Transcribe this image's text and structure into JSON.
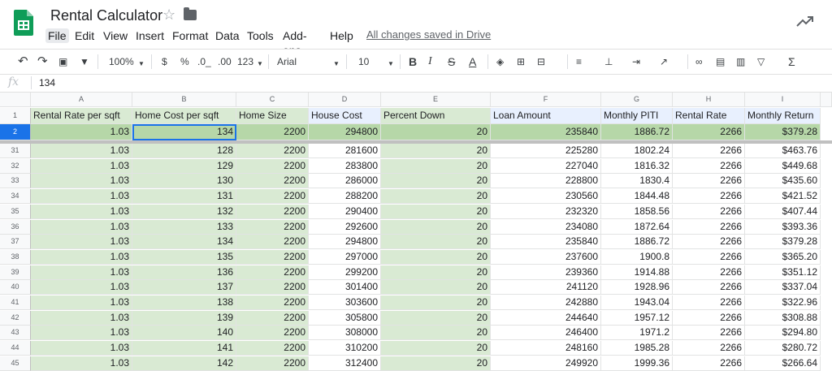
{
  "app": {
    "title": "Rental Calculator",
    "saved_status": "All changes saved in Drive",
    "menus": [
      "File",
      "Edit",
      "View",
      "Insert",
      "Format",
      "Data",
      "Tools",
      "Add-ons",
      "Help"
    ]
  },
  "toolbar": {
    "zoom": "100%",
    "currency": "$",
    "percent": "%",
    "dec_decrease": ".0_",
    "dec_increase": ".00",
    "more_formats": "123",
    "font": "Arial",
    "font_size": "10",
    "bold": "B",
    "italic": "I",
    "strike": "S",
    "text_color": "A",
    "sum": "Σ"
  },
  "formula_bar": {
    "fx": "fx",
    "value": "134"
  },
  "columns": [
    "A",
    "B",
    "C",
    "D",
    "E",
    "F",
    "G",
    "H",
    "I"
  ],
  "header_row": {
    "num": "1",
    "cells": [
      "Rental Rate per sqft",
      "Home Cost per sqft",
      "Home Size",
      "House Cost",
      "Percent Down",
      "Loan Amount",
      "Monthly PITI",
      "Rental Rate",
      "Monthly Return"
    ]
  },
  "frozen_row": {
    "num": "2",
    "cells": [
      "1.03",
      "134",
      "2200",
      "294800",
      "20",
      "235840",
      "1886.72",
      "2266",
      "$379.28"
    ]
  },
  "rows": [
    {
      "num": "31",
      "cells": [
        "1.03",
        "128",
        "2200",
        "281600",
        "20",
        "225280",
        "1802.24",
        "2266",
        "$463.76"
      ]
    },
    {
      "num": "32",
      "cells": [
        "1.03",
        "129",
        "2200",
        "283800",
        "20",
        "227040",
        "1816.32",
        "2266",
        "$449.68"
      ]
    },
    {
      "num": "33",
      "cells": [
        "1.03",
        "130",
        "2200",
        "286000",
        "20",
        "228800",
        "1830.4",
        "2266",
        "$435.60"
      ]
    },
    {
      "num": "34",
      "cells": [
        "1.03",
        "131",
        "2200",
        "288200",
        "20",
        "230560",
        "1844.48",
        "2266",
        "$421.52"
      ]
    },
    {
      "num": "35",
      "cells": [
        "1.03",
        "132",
        "2200",
        "290400",
        "20",
        "232320",
        "1858.56",
        "2266",
        "$407.44"
      ]
    },
    {
      "num": "36",
      "cells": [
        "1.03",
        "133",
        "2200",
        "292600",
        "20",
        "234080",
        "1872.64",
        "2266",
        "$393.36"
      ]
    },
    {
      "num": "37",
      "cells": [
        "1.03",
        "134",
        "2200",
        "294800",
        "20",
        "235840",
        "1886.72",
        "2266",
        "$379.28"
      ]
    },
    {
      "num": "38",
      "cells": [
        "1.03",
        "135",
        "2200",
        "297000",
        "20",
        "237600",
        "1900.8",
        "2266",
        "$365.20"
      ]
    },
    {
      "num": "39",
      "cells": [
        "1.03",
        "136",
        "2200",
        "299200",
        "20",
        "239360",
        "1914.88",
        "2266",
        "$351.12"
      ]
    },
    {
      "num": "40",
      "cells": [
        "1.03",
        "137",
        "2200",
        "301400",
        "20",
        "241120",
        "1928.96",
        "2266",
        "$337.04"
      ]
    },
    {
      "num": "41",
      "cells": [
        "1.03",
        "138",
        "2200",
        "303600",
        "20",
        "242880",
        "1943.04",
        "2266",
        "$322.96"
      ]
    },
    {
      "num": "42",
      "cells": [
        "1.03",
        "139",
        "2200",
        "305800",
        "20",
        "244640",
        "1957.12",
        "2266",
        "$308.88"
      ]
    },
    {
      "num": "43",
      "cells": [
        "1.03",
        "140",
        "2200",
        "308000",
        "20",
        "246400",
        "1971.2",
        "2266",
        "$294.80"
      ]
    },
    {
      "num": "44",
      "cells": [
        "1.03",
        "141",
        "2200",
        "310200",
        "20",
        "248160",
        "1985.28",
        "2266",
        "$280.72"
      ]
    },
    {
      "num": "45",
      "cells": [
        "1.03",
        "142",
        "2200",
        "312400",
        "20",
        "249920",
        "1999.36",
        "2266",
        "$266.64"
      ]
    }
  ],
  "colors": {
    "green": "#d9ead3",
    "blue": "#e8f0fe",
    "active": "#1a73e8"
  }
}
